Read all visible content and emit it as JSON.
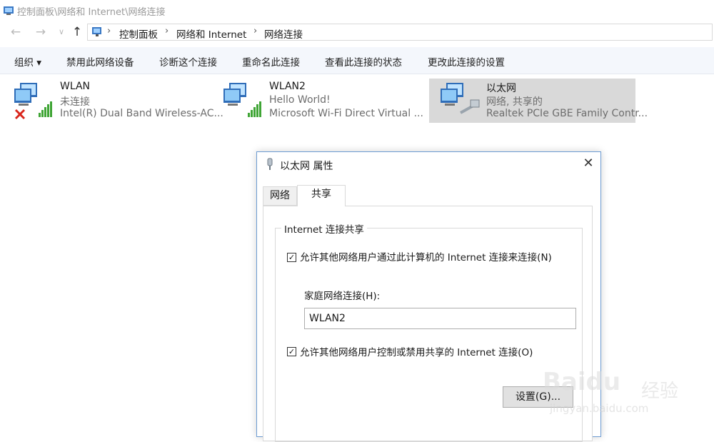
{
  "window": {
    "title": "控制面板\\网络和 Internet\\网络连接"
  },
  "nav": {
    "back_icon": "back-arrow-icon",
    "forward_icon": "forward-arrow-icon",
    "recent_icon": "chevron-down-icon",
    "up_icon": "up-arrow-icon",
    "breadcrumb": [
      "控制面板",
      "网络和 Internet",
      "网络连接"
    ],
    "separator": "›"
  },
  "commands": {
    "organize": "组织 ▾",
    "disable": "禁用此网络设备",
    "diagnose": "诊断这个连接",
    "rename": "重命名此连接",
    "status": "查看此连接的状态",
    "change": "更改此连接的设置"
  },
  "connections": [
    {
      "name": "WLAN",
      "status": "未连接",
      "device": "Intel(R) Dual Band Wireless-AC...",
      "icon": "wireless-network-icon",
      "overlay_icon": "disconnected-x-icon"
    },
    {
      "name": "WLAN2",
      "status": "Hello World!",
      "device": "Microsoft Wi-Fi Direct Virtual ...",
      "icon": "wireless-network-icon"
    },
    {
      "name": "以太网",
      "status": "网络, 共享的",
      "device": "Realtek PCIe GBE Family Contr...",
      "icon": "ethernet-network-icon",
      "selected": true
    }
  ],
  "dialog": {
    "title": "以太网 属性",
    "title_icon": "ethernet-plug-icon",
    "close": "✕",
    "tabs": [
      "网络",
      "共享"
    ],
    "active_tab": "共享",
    "group_label": "Internet 连接共享",
    "allow_share_label": "允许其他网络用户通过此计算机的 Internet 连接来连接(N)",
    "allow_share_checked": true,
    "home_label": "家庭网络连接(H):",
    "home_value": "WLAN2",
    "allow_control_label": "允许其他网络用户控制或禁用共享的 Internet 连接(O)",
    "allow_control_checked": true,
    "settings_button": "设置(G)..."
  },
  "watermark": {
    "brand": "Baidu",
    "brand_cn": "经验",
    "url": "jingyan.baidu.com"
  },
  "colors": {
    "command_bar": "#f4f7fc",
    "selected_tile": "#d9d9d9",
    "dialog_border": "#6c9bd2"
  }
}
